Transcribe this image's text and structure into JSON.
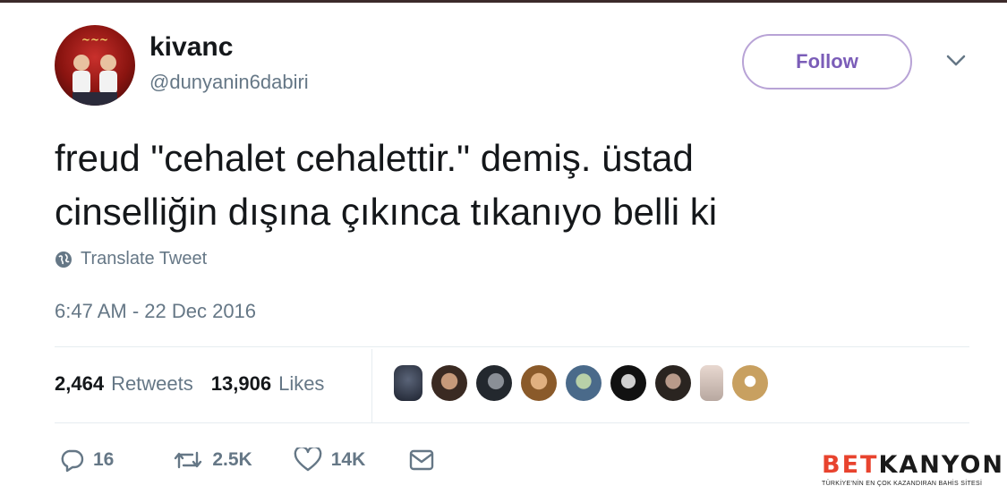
{
  "user": {
    "name": "kivanc",
    "handle": "@dunyanin6dabiri"
  },
  "follow_label": "Follow",
  "tweet": {
    "lines": [
      "freud \"cehalet cehalettir.\" demiş. üstad",
      "cinselliğin dışına çıkınca tıkanıyo belli ki"
    ],
    "translate_label": "Translate Tweet",
    "timestamp": "6:47 AM - 22 Dec 2016"
  },
  "stats": {
    "retweets_count": "2,464",
    "retweets_label": "Retweets",
    "likes_count": "13,906",
    "likes_label": "Likes"
  },
  "actions": {
    "reply_count": "16",
    "retweet_count": "2.5K",
    "like_count": "14K"
  },
  "watermark": {
    "part1": "BET",
    "part2": "KANYON",
    "tagline": "TÜRKİYE'NİN EN ÇOK KAZANDIRAN BAHİS SİTESİ"
  },
  "colors": {
    "follow_border": "#b8a3d6",
    "follow_text": "#7b5db8",
    "secondary_text": "#657786",
    "brand_red": "#e8432e"
  }
}
